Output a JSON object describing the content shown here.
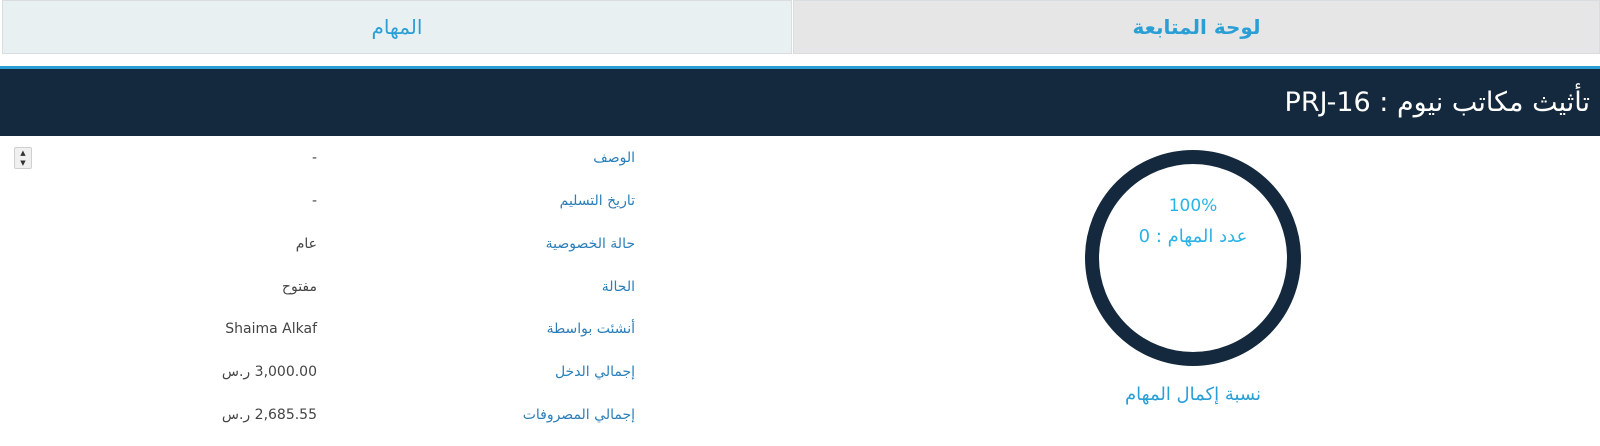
{
  "tabs": {
    "dashboard_label": "لوحة المتابعة",
    "tasks_label": "المهام"
  },
  "header": {
    "title": "PRJ-16 : تأثيث مكاتب نيوم"
  },
  "details": {
    "rows": [
      {
        "label": "الوصف",
        "value": "-"
      },
      {
        "label": "تاريخ التسليم",
        "value": "-"
      },
      {
        "label": "حالة الخصوصية",
        "value": "عام"
      },
      {
        "label": "الحالة",
        "value": "مفتوح"
      },
      {
        "label": "أنشئت بواسطة",
        "value": "Shaima Alkaf"
      },
      {
        "label": "إجمالي الدخل",
        "value": "3,000.00 ر.س"
      },
      {
        "label": "إجمالي المصروفات",
        "value": "2,685.55 ر.س"
      }
    ]
  },
  "progress": {
    "percent_text": "100%",
    "task_count_text": "عدد المهام : 0",
    "caption": "نسبة إكمال المهام",
    "completion_fraction": 1.0,
    "ring_color": "#14293d"
  },
  "colors": {
    "accent": "#2a9fd6",
    "header_bg": "#14293d"
  }
}
